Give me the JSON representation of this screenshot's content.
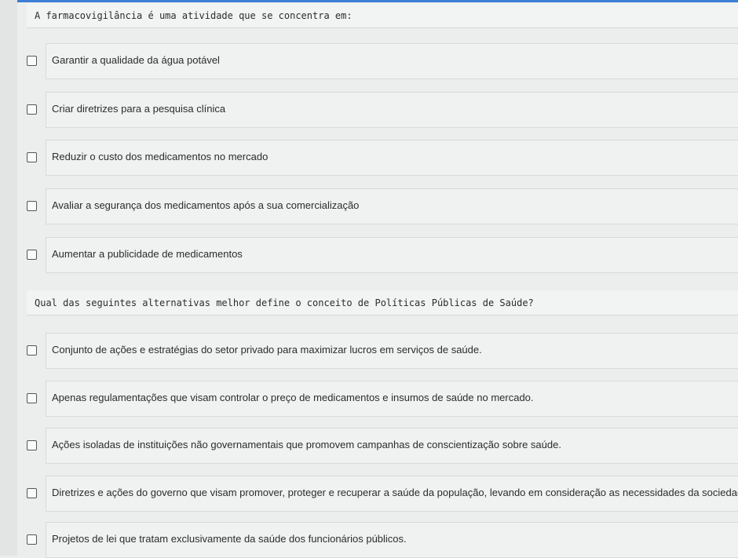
{
  "questions": [
    {
      "text": "A farmacovigilância é uma atividade que se concentra em:",
      "options": [
        "Garantir a qualidade da água potável",
        "Criar diretrizes para a pesquisa clínica",
        "Reduzir o custo dos medicamentos no mercado",
        "Avaliar a segurança dos medicamentos após a sua comercialização",
        "Aumentar a publicidade de medicamentos"
      ]
    },
    {
      "text": "Qual das seguintes alternativas melhor define o conceito de Políticas Públicas de Saúde?",
      "options": [
        "Conjunto de ações e estratégias do setor privado para maximizar lucros em serviços de saúde.",
        "Apenas regulamentações que visam controlar o preço de medicamentos e insumos de saúde no mercado.",
        "Ações isoladas de instituições não governamentais que promovem campanhas de conscientização sobre saúde.",
        "Diretrizes e ações do governo que visam promover, proteger e recuperar a saúde da população, levando em consideração as necessidades da sociedade.",
        "Projetos de lei que tratam exclusivamente da saúde dos funcionários públicos."
      ]
    }
  ],
  "colors": {
    "accent": "#3c7ed6",
    "background": "#eceeee"
  }
}
